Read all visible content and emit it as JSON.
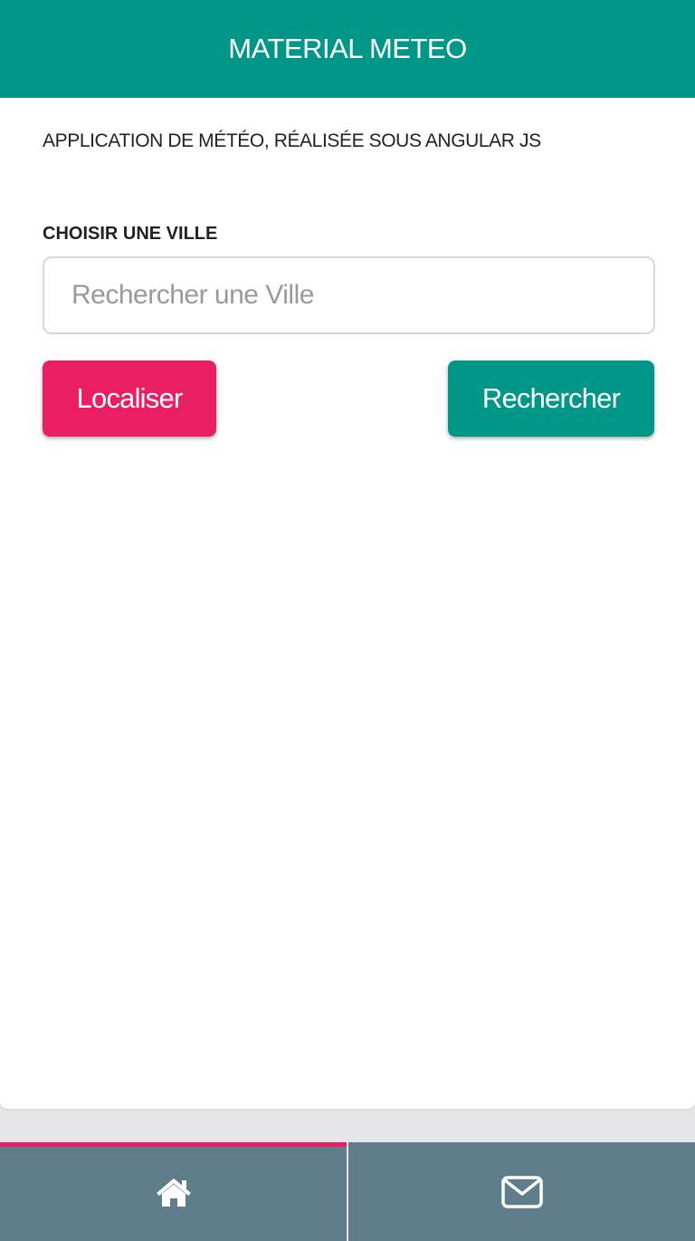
{
  "header": {
    "title": "MATERIAL METEO"
  },
  "main": {
    "subtitle": "APPLICATION DE MÉTÉO, RÉALISÉE SOUS ANGULAR JS",
    "city_label": "CHOISIR UNE VILLE",
    "search": {
      "placeholder": "Rechercher une Ville",
      "value": ""
    },
    "localiser_label": "Localiser",
    "rechercher_label": "Rechercher"
  },
  "bottom_nav": {
    "items": [
      {
        "icon": "home-icon",
        "active": true
      },
      {
        "icon": "envelope-icon",
        "active": false
      }
    ]
  },
  "colors": {
    "primary": "#009688",
    "accent": "#e91e63",
    "nav_background": "#607d8b"
  }
}
